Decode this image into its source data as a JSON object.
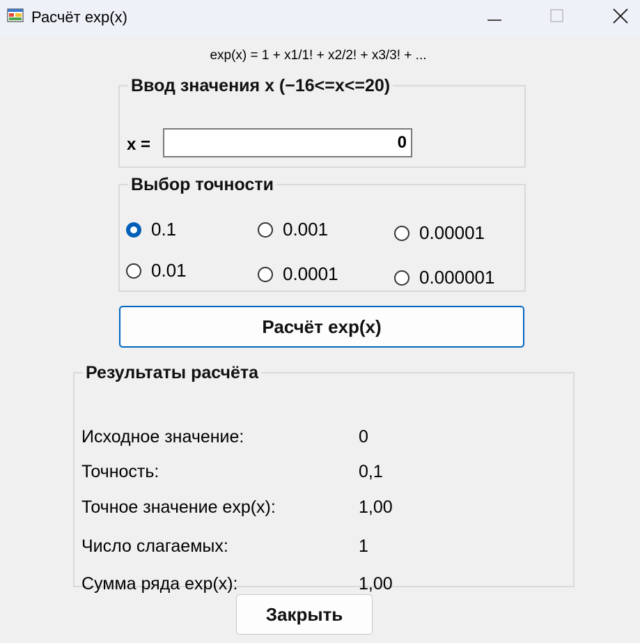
{
  "window": {
    "title": "Расчёт exp(x)",
    "icon": "windows-form-icon",
    "controls": [
      "minimize-icon",
      "maximize-icon",
      "close-icon"
    ]
  },
  "formula": "exp(x) = 1 + x1/1! + x2/2! + x3/3! + ...",
  "input_group": {
    "legend": "Ввод значения x (−16<=x<=20)",
    "x_label": "x =",
    "x_value": "0"
  },
  "precision_group": {
    "legend": "Выбор точности",
    "options": [
      {
        "label": "0.1",
        "checked": true
      },
      {
        "label": "0.001",
        "checked": false
      },
      {
        "label": "0.00001",
        "checked": false
      },
      {
        "label": "0.01",
        "checked": false
      },
      {
        "label": "0.0001",
        "checked": false
      },
      {
        "label": "0.000001",
        "checked": false
      }
    ]
  },
  "calc_button": "Расчёт exp(x)",
  "results_group": {
    "legend": "Результаты расчёта",
    "rows": [
      {
        "label": "Исходное значение:",
        "value": "0"
      },
      {
        "label": "Точность:",
        "value": "0,1"
      },
      {
        "label": "Точное значение exp(x):",
        "value": "1,00"
      },
      {
        "label": "Число слагаемых:",
        "value": "1"
      },
      {
        "label": "Сумма ряда exp(x):",
        "value": "1,00"
      }
    ]
  },
  "close_button": "Закрыть",
  "colors": {
    "accent": "#005fb8",
    "button_focus_border": "#0067c0",
    "window_bg": "#f0f0f0",
    "titlebar_bg": "#eef2f8"
  }
}
